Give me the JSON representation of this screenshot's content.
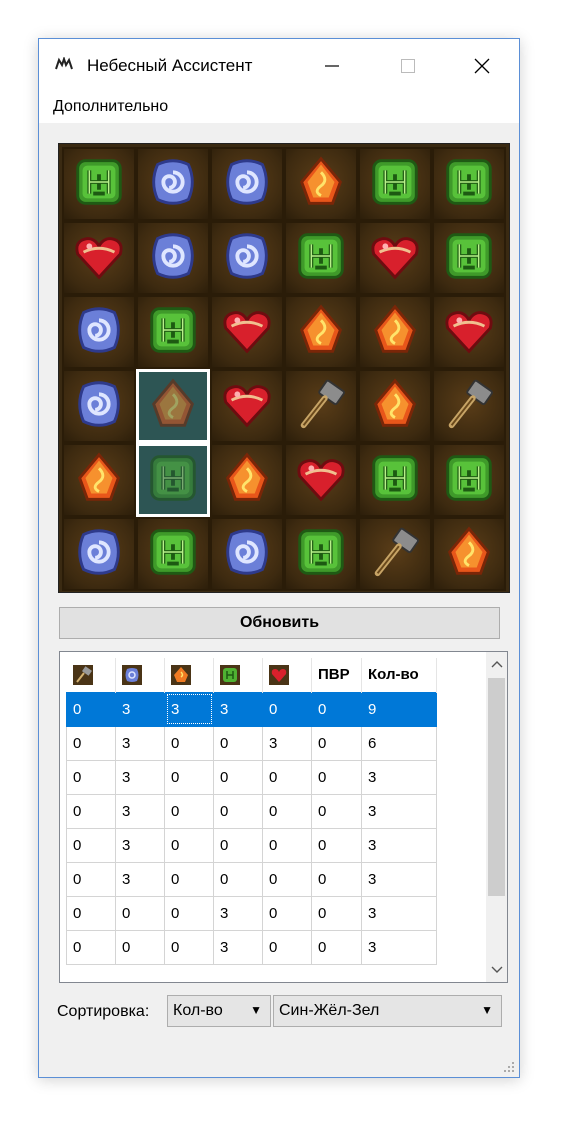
{
  "window": {
    "title": "Небесный Ассистент"
  },
  "menu": {
    "item": "Дополнительно"
  },
  "board": {
    "rows": [
      [
        "green",
        "blue",
        "blue",
        "orange",
        "green",
        "green"
      ],
      [
        "red",
        "blue",
        "blue",
        "green",
        "red",
        "green"
      ],
      [
        "blue",
        "green",
        "red",
        "orange",
        "orange",
        "red"
      ],
      [
        "blue",
        "orange",
        "red",
        "hammer",
        "orange",
        "hammer"
      ],
      [
        "orange",
        "green",
        "orange",
        "red",
        "green",
        "green"
      ],
      [
        "blue",
        "green",
        "blue",
        "green",
        "hammer",
        "orange"
      ]
    ],
    "selected_cells": [
      [
        3,
        1
      ],
      [
        4,
        1
      ]
    ]
  },
  "refresh_label": "Обновить",
  "table": {
    "columns": [
      {
        "icon": "hammer-icon",
        "label": ""
      },
      {
        "icon": "blue-gem-icon",
        "label": ""
      },
      {
        "icon": "orange-gem-icon",
        "label": ""
      },
      {
        "icon": "green-gem-icon",
        "label": ""
      },
      {
        "icon": "heart-icon",
        "label": ""
      },
      {
        "icon": "",
        "label": "ПВР"
      },
      {
        "icon": "",
        "label": "Кол-во"
      }
    ],
    "rows": [
      [
        "0",
        "3",
        "3",
        "3",
        "0",
        "0",
        "9"
      ],
      [
        "0",
        "3",
        "0",
        "0",
        "3",
        "0",
        "6"
      ],
      [
        "0",
        "3",
        "0",
        "0",
        "0",
        "0",
        "3"
      ],
      [
        "0",
        "3",
        "0",
        "0",
        "0",
        "0",
        "3"
      ],
      [
        "0",
        "3",
        "0",
        "0",
        "0",
        "0",
        "3"
      ],
      [
        "0",
        "3",
        "0",
        "0",
        "0",
        "0",
        "3"
      ],
      [
        "0",
        "0",
        "0",
        "3",
        "0",
        "0",
        "3"
      ],
      [
        "0",
        "0",
        "0",
        "3",
        "0",
        "0",
        "3"
      ]
    ],
    "selected_row": 0
  },
  "sort": {
    "label": "Сортировка:",
    "field": "Кол-во",
    "order": "Син-Жёл-Зел"
  }
}
